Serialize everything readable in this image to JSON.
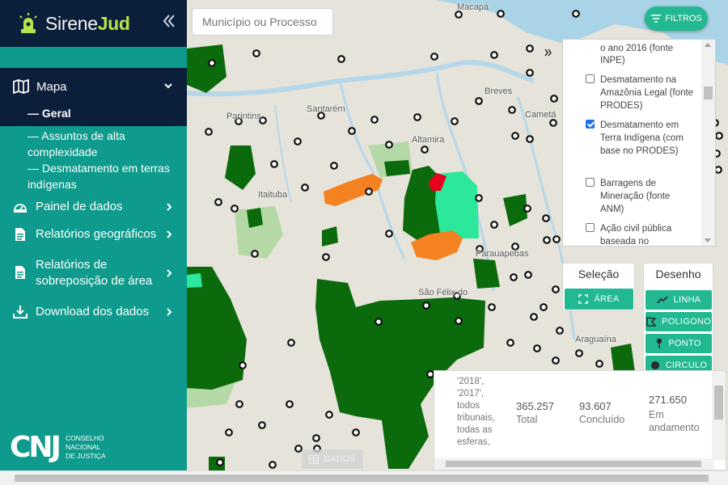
{
  "app": {
    "logo_prefix": "Sirene",
    "logo_suffix": "Jud"
  },
  "sidebar": {
    "mapa_label": "Mapa",
    "sub_items": [
      "— Geral",
      "— Assuntos de alta complexidade",
      "— Desmatamento em terras indígenas"
    ],
    "items": [
      {
        "label": "Painel de dados",
        "icon": "dashboard-icon"
      },
      {
        "label": "Relatórios geográficos",
        "icon": "report-icon"
      },
      {
        "label": "Relatórios de sobreposição de área",
        "icon": "report-icon"
      },
      {
        "label": "Download dos dados",
        "icon": "download-icon"
      }
    ],
    "footer": {
      "logo": "CNJ",
      "lines": [
        "CONSELHO",
        "NACIONAL",
        "DE JUSTIÇA"
      ]
    }
  },
  "search": {
    "placeholder": "Município ou Processo"
  },
  "filters_button": {
    "label": "FILTROS"
  },
  "layers": {
    "partial_top": "o ano 2016 (fonte INPE)",
    "items": [
      {
        "label": "Desmatamento na Amazônia Legal (fonte PRODES)",
        "checked": false
      },
      {
        "label": "Desmatamento em Terra Indígena (com base no PRODES)",
        "checked": true
      },
      {
        "label": "Barragens de Mineração (fonte ANM)",
        "checked": false
      },
      {
        "label": "Ação civil pública baseada no",
        "checked": false
      }
    ]
  },
  "selection": {
    "title": "Seleção",
    "area_label": "ÁREA"
  },
  "drawing": {
    "title": "Desenho",
    "buttons": [
      {
        "label": "LINHA",
        "icon": "line-icon"
      },
      {
        "label": "POLIGONO",
        "icon": "polygon-icon"
      },
      {
        "label": "PONTO",
        "icon": "pin-icon"
      },
      {
        "label": "CIRCULO",
        "icon": "circle-icon"
      }
    ]
  },
  "stats": {
    "filter_text": "'2018', '2017', todos tribunais, todas as esferas,",
    "total": {
      "value": "365.257",
      "label": "Total"
    },
    "concluded": {
      "value": "93.607",
      "label": "Concluído"
    },
    "ongoing": {
      "value": "271.650",
      "label": "Em andamento"
    }
  },
  "dados_tab": "DADOS",
  "map_labels": [
    "Macapá",
    "Breves",
    "Santarém",
    "Parintins",
    "Cametá",
    "Altamira",
    "Itaituba",
    "Parauapebas",
    "São Félix do",
    "Araguaína"
  ],
  "colors": {
    "sidebar": "#0e9a8c",
    "sidebar_dark": "#0b1e3a",
    "accent": "#21b892",
    "indigenous_green": "#0b6a0b",
    "deforest_orange": "#f58220",
    "alert_red": "#e8001c",
    "light_green": "#2ce89b"
  }
}
